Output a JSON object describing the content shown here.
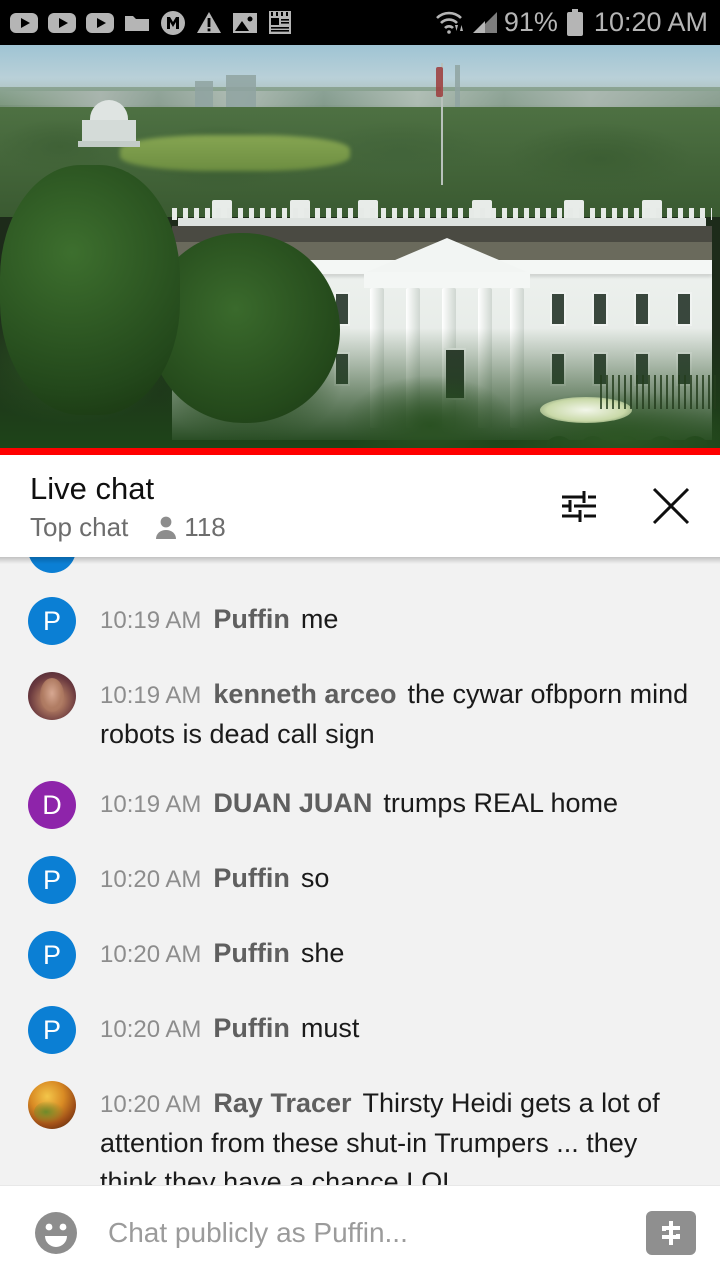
{
  "status_bar": {
    "left_icons": [
      "youtube-play-icon",
      "youtube-play-icon",
      "youtube-play-icon",
      "folder-icon",
      "m-circle-icon",
      "warning-triangle-icon",
      "image-icon",
      "notepad-icon"
    ],
    "wifi_icon": "wifi-data-transfer-icon",
    "signal_icon": "cellular-signal-icon",
    "battery_percent": "91%",
    "battery_icon": "battery-icon",
    "clock": "10:20 AM"
  },
  "video": {
    "description": "White House live stream",
    "progress_percent": 100,
    "progress_color": "#ff0000"
  },
  "chat_header": {
    "title": "Live chat",
    "mode": "Top chat",
    "viewer_count": "118",
    "viewers_icon": "person-icon",
    "settings_icon": "chat-settings-sliders-icon",
    "close_icon": "close-icon"
  },
  "messages": [
    {
      "time": "10:19 AM",
      "author": "Puffin",
      "text": "me",
      "avatar_type": "initial",
      "avatar_initial": "P",
      "avatar_color": "#0b7fd4"
    },
    {
      "time": "10:19 AM",
      "author": "kenneth arceo",
      "text": "the cywar ofbporn mind robots is dead call sign",
      "avatar_type": "photo-k",
      "avatar_initial": "",
      "avatar_color": "#7a4a52"
    },
    {
      "time": "10:19 AM",
      "author": "DUAN JUAN",
      "text": "trumps REAL home",
      "avatar_type": "initial",
      "avatar_initial": "D",
      "avatar_color": "#8e24aa"
    },
    {
      "time": "10:20 AM",
      "author": "Puffin",
      "text": "so",
      "avatar_type": "initial",
      "avatar_initial": "P",
      "avatar_color": "#0b7fd4"
    },
    {
      "time": "10:20 AM",
      "author": "Puffin",
      "text": "she",
      "avatar_type": "initial",
      "avatar_initial": "P",
      "avatar_color": "#0b7fd4"
    },
    {
      "time": "10:20 AM",
      "author": "Puffin",
      "text": "must",
      "avatar_type": "initial",
      "avatar_initial": "P",
      "avatar_color": "#0b7fd4"
    },
    {
      "time": "10:20 AM",
      "author": "Ray Tracer",
      "text": "Thirsty Heidi gets a lot of attention from these shut-in Trumpers ... they think they have a chance LOL",
      "avatar_type": "photo-r",
      "avatar_initial": "",
      "avatar_color": "#c98a22"
    }
  ],
  "composer": {
    "emoji_icon": "emoji-smiley-icon",
    "placeholder": "Chat publicly as Puffin...",
    "value": "",
    "superchat_icon": "super-chat-dollar-icon"
  }
}
